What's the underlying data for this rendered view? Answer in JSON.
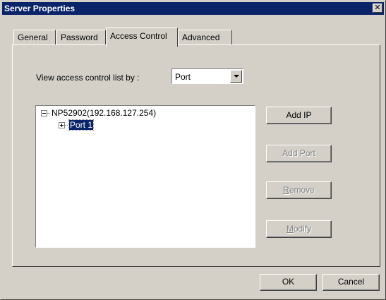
{
  "window": {
    "title": "Server Properties"
  },
  "tabs": [
    {
      "label": "General"
    },
    {
      "label": "Password"
    },
    {
      "label": "Access Control"
    },
    {
      "label": "Advanced"
    }
  ],
  "active_tab": "Access Control",
  "access_control": {
    "view_label": "View access control list by :",
    "view_by_value": "Port",
    "tree": {
      "root_label": "NP52902(192.168.127.254)",
      "child_label": "Port 1"
    },
    "buttons": {
      "add_ip": "Add IP",
      "add_port": "Add Port",
      "remove_first": "R",
      "remove_rest": "emove",
      "modify_first": "M",
      "modify_rest": "odify"
    }
  },
  "footer": {
    "ok_label": "OK",
    "cancel_label": "Cancel"
  }
}
